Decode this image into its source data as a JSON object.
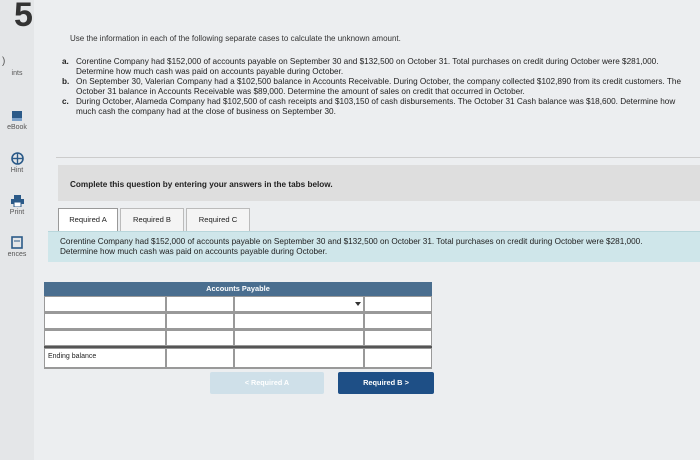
{
  "question": {
    "number": "5"
  },
  "sidebar": {
    "paren": ")",
    "items": [
      {
        "label": "ints"
      },
      {
        "label": "eBook"
      },
      {
        "label": "Hint"
      },
      {
        "label": "Print"
      },
      {
        "label": "ences"
      }
    ]
  },
  "instructions": "Use the information in each of the following separate cases to calculate the unknown amount.",
  "cases": [
    {
      "label": "a.",
      "text": "Corentine Company had $152,000 of accounts payable on September 30 and $132,500 on October 31. Total purchases on credit during October were $281,000. Determine how much cash was paid on accounts payable during October."
    },
    {
      "label": "b.",
      "text": "On September 30, Valerian Company had a $102,500 balance in Accounts Receivable. During October, the company collected $102,890 from its credit customers. The October 31 balance in Accounts Receivable was $89,000. Determine the amount of sales on credit that occurred in October."
    },
    {
      "label": "c.",
      "text": "During October, Alameda Company had $102,500 of cash receipts and $103,150 of cash disbursements. The October 31 Cash balance was $18,600. Determine how much cash the company had at the close of business on September 30."
    }
  ],
  "complete_prompt": "Complete this question by entering your answers in the tabs below.",
  "tabs": [
    {
      "label": "Required A"
    },
    {
      "label": "Required B"
    },
    {
      "label": "Required C"
    }
  ],
  "required_prompt": "Corentine Company had $152,000 of accounts payable on September 30 and $132,500 on October 31. Total purchases on credit during October were $281,000. Determine how much cash was paid on accounts payable during October.",
  "table": {
    "header": "Accounts Payable",
    "ending_label": "Ending balance"
  },
  "nav": {
    "prev_label": "< Required A",
    "next_label": "Required B  >"
  }
}
